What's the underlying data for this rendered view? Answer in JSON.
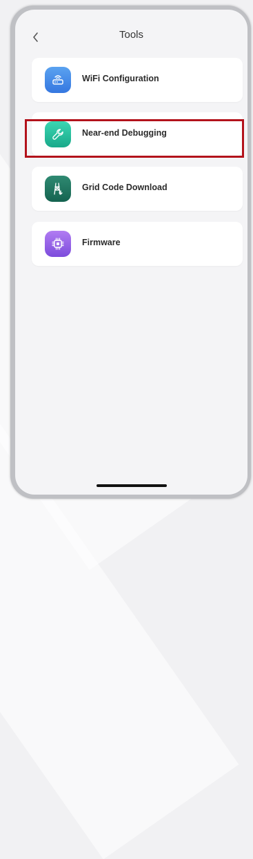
{
  "header": {
    "title": "Tools"
  },
  "tools": [
    {
      "label": "WiFi Configuration",
      "icon": "router-icon",
      "color_top": "#5aa2f0",
      "color_bottom": "#3577e0"
    },
    {
      "label": "Near-end Debugging",
      "icon": "wrench-icon",
      "color_top": "#3bd6b2",
      "color_bottom": "#19a98a"
    },
    {
      "label": "Grid Code Download",
      "icon": "tower-icon",
      "color_top": "#2f8a72",
      "color_bottom": "#156350"
    },
    {
      "label": "Firmware",
      "icon": "chip-icon",
      "color_top": "#b17cf2",
      "color_bottom": "#7c4cdc"
    }
  ],
  "highlight_color": "#b3121b",
  "highlighted_item": "Near-end Debugging"
}
